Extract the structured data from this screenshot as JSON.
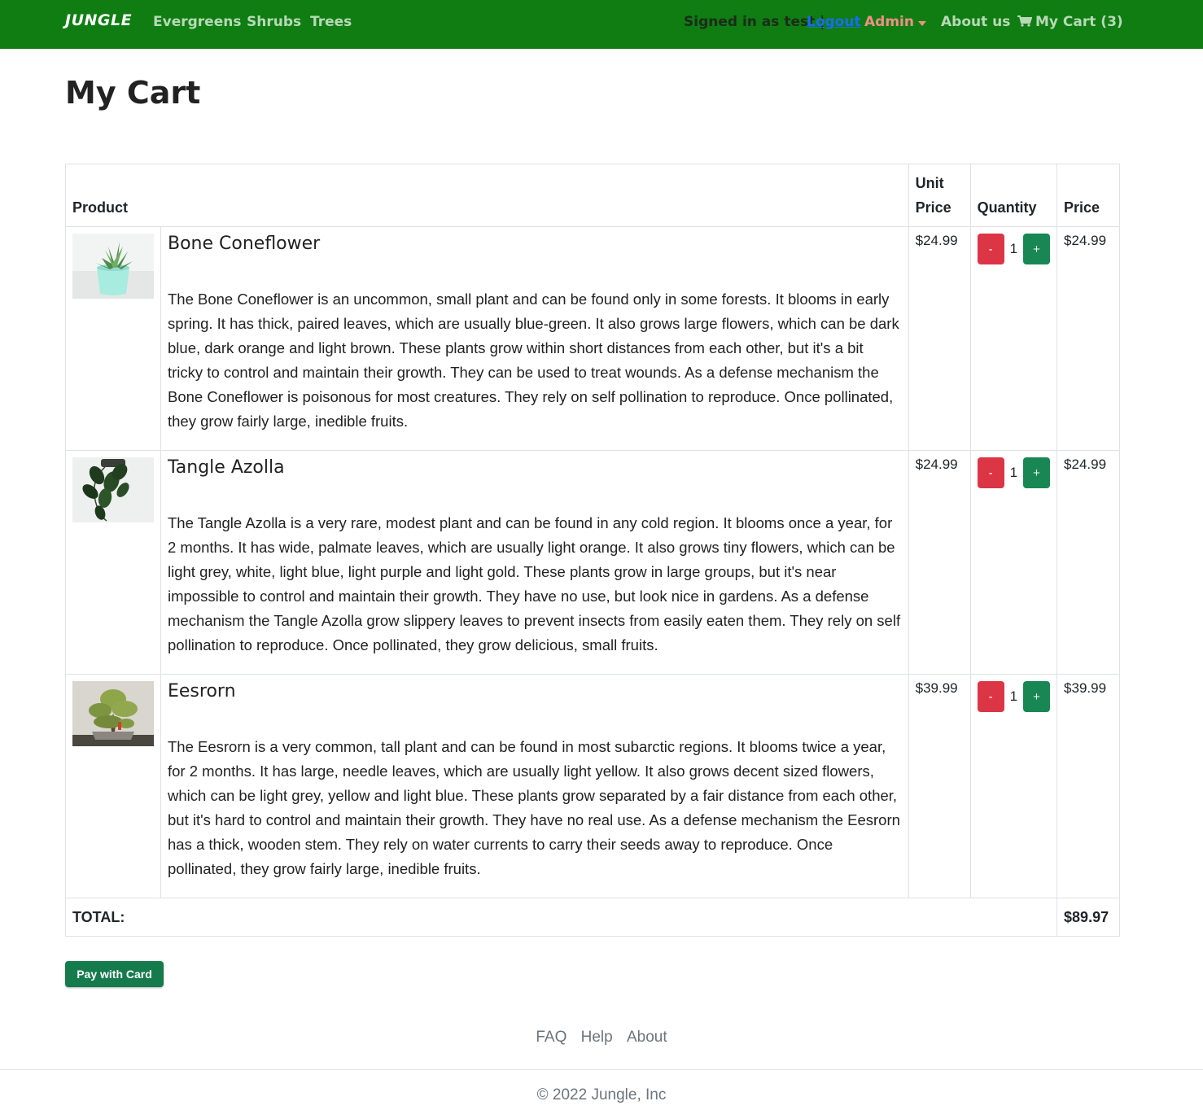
{
  "navbar": {
    "brand": "JUNGLE",
    "links": [
      "Evergreens",
      "Shrubs",
      "Trees"
    ],
    "signed_in_text": "Signed in as test |",
    "logout_label": "Logout",
    "admin_label": "Admin",
    "about_label": "About us",
    "cart_label": "My Cart (3)",
    "color": "#0f7d12"
  },
  "page_title": "My Cart",
  "table": {
    "headers": {
      "product": "Product",
      "unit_price": "Unit Price",
      "quantity": "Quantity",
      "price": "Price"
    },
    "rows": [
      {
        "name": "Bone Coneflower",
        "description": "The Bone Coneflower is an uncommon, small plant and can be found only in some forests. It blooms in early spring. It has thick, paired leaves, which are usually blue-green. It also grows large flowers, which can be dark blue, dark orange and light brown. These plants grow within short distances from each other, but it's a bit tricky to control and maintain their growth. They can be used to treat wounds. As a defense mechanism the Bone Coneflower is poisonous for most creatures. They rely on self pollination to reproduce. Once pollinated, they grow fairly large, inedible fruits.",
        "unit_price": "$24.99",
        "quantity": "1",
        "price": "$24.99"
      },
      {
        "name": "Tangle Azolla",
        "description": "The Tangle Azolla is a very rare, modest plant and can be found in any cold region. It blooms once a year, for 2 months. It has wide, palmate leaves, which are usually light orange. It also grows tiny flowers, which can be light grey, white, light blue, light purple and light gold. These plants grow in large groups, but it's near impossible to control and maintain their growth. They have no use, but look nice in gardens. As a defense mechanism the Tangle Azolla grow slippery leaves to prevent insects from easily eaten them. They rely on self pollination to reproduce. Once pollinated, they grow delicious, small fruits.",
        "unit_price": "$24.99",
        "quantity": "1",
        "price": "$24.99"
      },
      {
        "name": "Eesrorn",
        "description": "The Eesrorn is a very common, tall plant and can be found in most subarctic regions. It blooms twice a year, for 2 months. It has large, needle leaves, which are usually light yellow. It also grows decent sized flowers, which can be light grey, yellow and light blue. These plants grow separated by a fair distance from each other, but it's hard to control and maintain their growth. They have no real use. As a defense mechanism the Eesrorn has a thick, wooden stem. They rely on water currents to carry their seeds away to reproduce. Once pollinated, they grow fairly large, inedible fruits.",
        "unit_price": "$39.99",
        "quantity": "1",
        "price": "$39.99"
      }
    ],
    "minus_label": "-",
    "plus_label": "+",
    "total_label": "TOTAL:",
    "total_value": "$89.97"
  },
  "pay_button": "Pay with Card",
  "footer": {
    "links": [
      "FAQ",
      "Help",
      "About"
    ],
    "copyright": "© 2022 Jungle, Inc"
  }
}
